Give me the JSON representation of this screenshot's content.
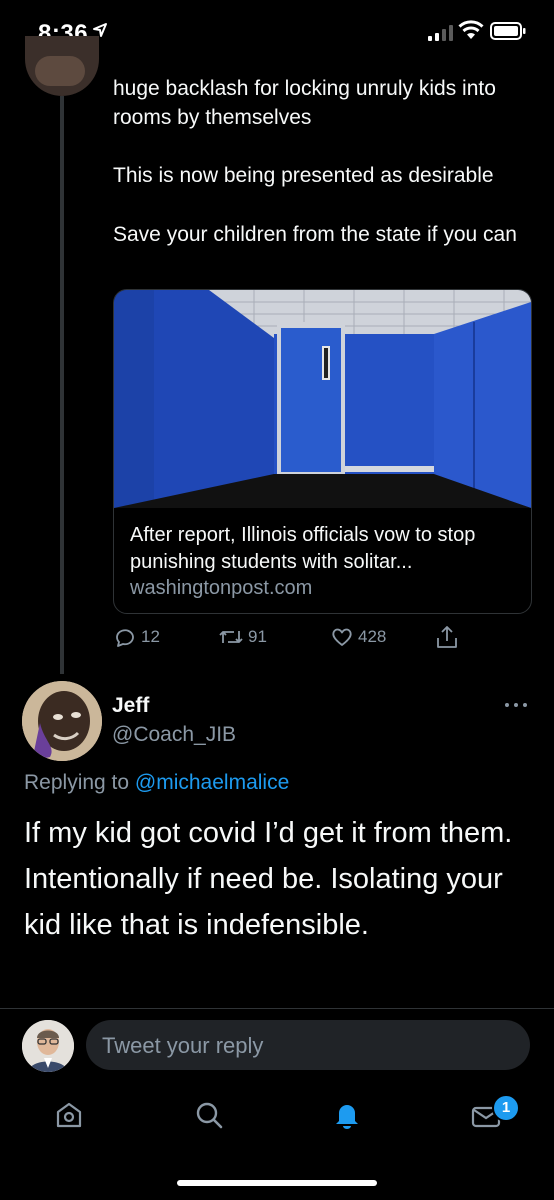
{
  "status_bar": {
    "time": "8:36"
  },
  "parent_tweet": {
    "lines_1": "huge backlash for locking unruly kids into rooms by themselves",
    "lines_2": "This is now being presented as desirable",
    "lines_3": "Save your children from the state if you can",
    "link_card": {
      "title": "After report, Illinois officials vow to stop punishing students with solitar...",
      "domain": "washingtonpost.com"
    },
    "actions": {
      "replies": "12",
      "retweets": "91",
      "likes": "428"
    }
  },
  "reply_tweet": {
    "name": "Jeff",
    "handle": "@Coach_JIB",
    "replying_prefix": "Replying to ",
    "replying_to": "@michaelmalice",
    "text": "If my kid got covid I’d get it from them. Intentionally if need be. Isolating your kid like that is indefensible."
  },
  "composer": {
    "placeholder": "Tweet your reply"
  },
  "tabbar": {
    "messages_badge": "1"
  },
  "colors": {
    "accent": "#1d9bf0",
    "muted": "#8b98a5",
    "text": "#f7f9f9"
  }
}
